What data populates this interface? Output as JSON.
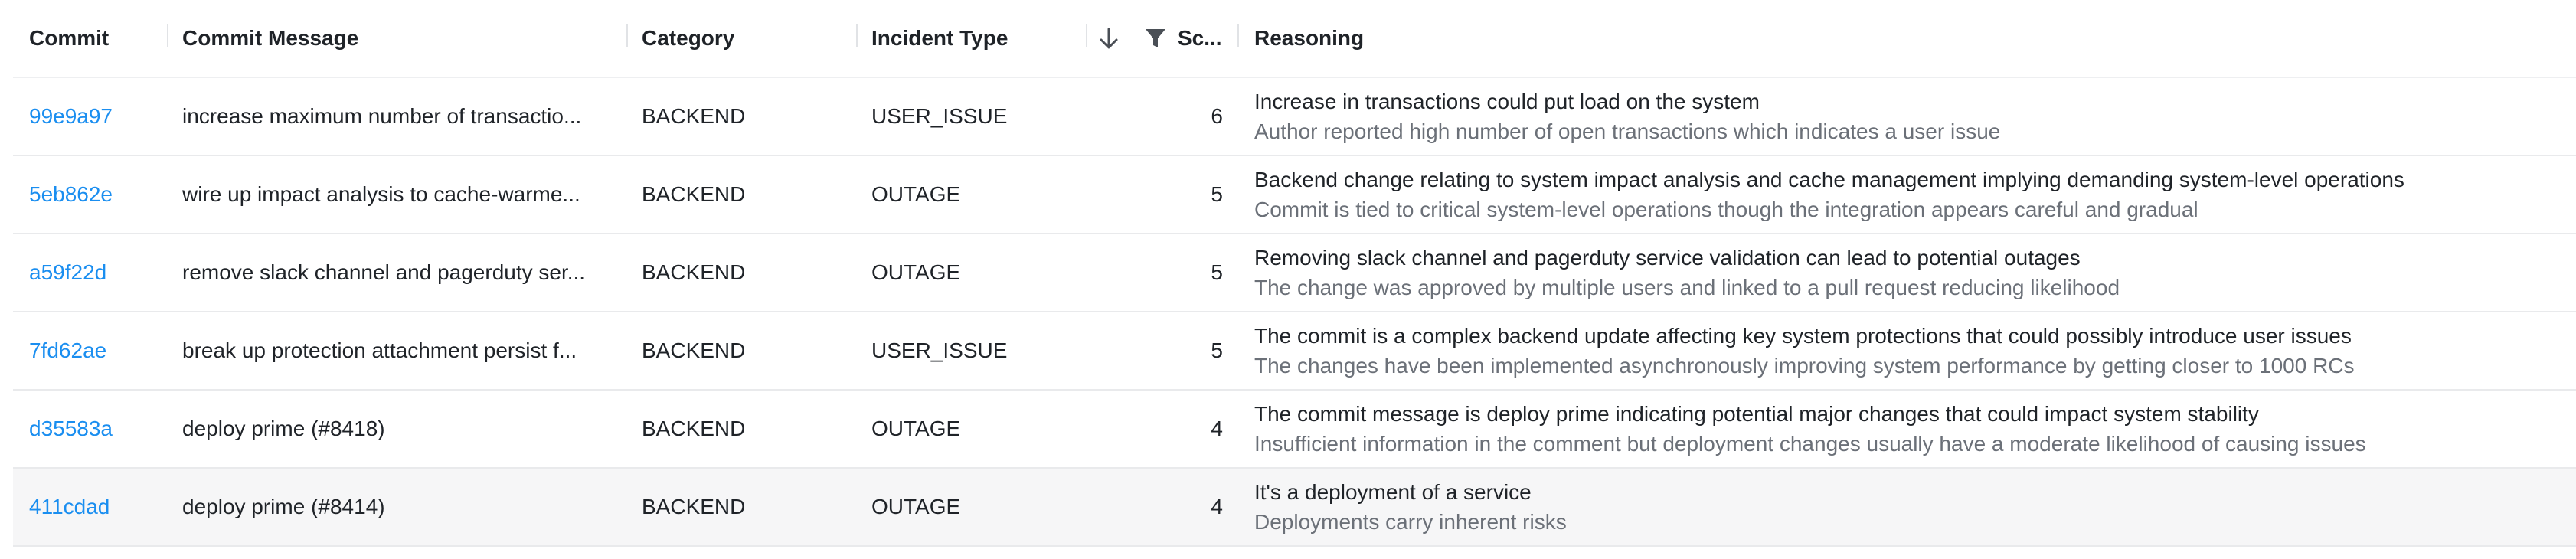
{
  "header": {
    "commit": "Commit",
    "message": "Commit Message",
    "category": "Category",
    "incident_type": "Incident Type",
    "score": "Sc...",
    "reasoning": "Reasoning"
  },
  "rows": [
    {
      "commit": "99e9a97",
      "message": "increase maximum number of transactio...",
      "category": "BACKEND",
      "incident_type": "USER_ISSUE",
      "score": "6",
      "reason_main": "Increase in transactions could put load on the system",
      "reason_sub": "Author reported high number of open transactions which indicates a user issue"
    },
    {
      "commit": "5eb862e",
      "message": "wire up impact analysis to cache-warme...",
      "category": "BACKEND",
      "incident_type": "OUTAGE",
      "score": "5",
      "reason_main": "Backend change relating to system impact analysis and cache management implying demanding system-level operations",
      "reason_sub": "Commit is tied to critical system-level operations though the integration appears careful and gradual"
    },
    {
      "commit": "a59f22d",
      "message": "remove slack channel and pagerduty ser...",
      "category": "BACKEND",
      "incident_type": "OUTAGE",
      "score": "5",
      "reason_main": "Removing slack channel and pagerduty service validation can lead to potential outages",
      "reason_sub": "The change was approved by multiple users and linked to a pull request reducing likelihood"
    },
    {
      "commit": "7fd62ae",
      "message": "break up protection attachment persist f...",
      "category": "BACKEND",
      "incident_type": "USER_ISSUE",
      "score": "5",
      "reason_main": "The commit is a complex backend update affecting key system protections that could possibly introduce user issues",
      "reason_sub": "The changes have been implemented asynchronously improving system performance by getting closer to 1000 RCs"
    },
    {
      "commit": "d35583a",
      "message": "deploy prime (#8418)",
      "category": "BACKEND",
      "incident_type": "OUTAGE",
      "score": "4",
      "reason_main": "The commit message is deploy prime indicating potential major changes that could impact system stability",
      "reason_sub": "Insufficient information in the comment but deployment changes usually have a moderate likelihood of causing issues"
    },
    {
      "commit": "411cdad",
      "message": "deploy prime (#8414)",
      "category": "BACKEND",
      "incident_type": "OUTAGE",
      "score": "4",
      "reason_main": "It's a deployment of a service",
      "reason_sub": "Deployments carry inherent risks"
    }
  ],
  "icons": {
    "sort": "arrow-down-icon",
    "filter": "filter-icon"
  },
  "colors": {
    "link": "#1a8ef0",
    "secondary_text": "#6b7078",
    "highlight_row": "#f6f6f7"
  }
}
